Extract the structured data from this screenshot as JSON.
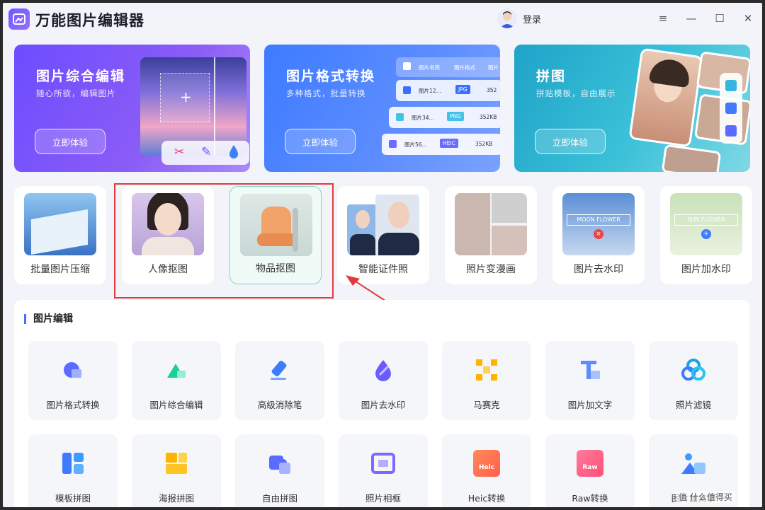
{
  "app": {
    "title": "万能图片编辑器",
    "login": "登录"
  },
  "window_controls": {
    "menu": "≡",
    "minimize": "—",
    "maximize": "☐",
    "close": "✕"
  },
  "banners": [
    {
      "title": "图片综合编辑",
      "subtitle": "随心所欲，编辑图片",
      "button": "立即体验"
    },
    {
      "title": "图片格式转换",
      "subtitle": "多种格式，批量转换",
      "button": "立即体验",
      "file_list": {
        "headers": [
          "图片名称",
          "图片格式",
          "图片"
        ],
        "rows": [
          {
            "name": "图片12...",
            "format": "JPG",
            "size": "352"
          },
          {
            "name": "图片34...",
            "format": "PNG",
            "size": "352KB"
          },
          {
            "name": "图片56...",
            "format": "HEIC",
            "size": "352KB"
          }
        ]
      }
    },
    {
      "title": "拼图",
      "subtitle": "拼贴模板，自由展示",
      "button": "立即体验"
    }
  ],
  "tools": [
    {
      "label": "批量图片压缩"
    },
    {
      "label": "人像抠图"
    },
    {
      "label": "物品抠图"
    },
    {
      "label": "智能证件照"
    },
    {
      "label": "照片变漫画"
    },
    {
      "label": "图片去水印",
      "overlay_text": "MOON FLOWER"
    },
    {
      "label": "图片加水印",
      "overlay_text": "SUN FLOWER"
    }
  ],
  "section": {
    "title": "图片编辑"
  },
  "features_row1": [
    {
      "label": "图片格式转换",
      "icon": "format-convert-icon"
    },
    {
      "label": "图片综合编辑",
      "icon": "image-edit-icon"
    },
    {
      "label": "高级消除笔",
      "icon": "eraser-pen-icon"
    },
    {
      "label": "图片去水印",
      "icon": "watermark-remove-icon"
    },
    {
      "label": "马赛克",
      "icon": "mosaic-icon"
    },
    {
      "label": "图片加文字",
      "icon": "add-text-icon"
    },
    {
      "label": "照片滤镜",
      "icon": "filter-icon"
    }
  ],
  "features_row2": [
    {
      "label": "模板拼图",
      "icon": "template-collage-icon"
    },
    {
      "label": "海报拼图",
      "icon": "poster-collage-icon"
    },
    {
      "label": "自由拼图",
      "icon": "free-collage-icon"
    },
    {
      "label": "照片相框",
      "icon": "photo-frame-icon"
    },
    {
      "label": "Heic转换",
      "icon": "heic-icon",
      "badge": "Heic"
    },
    {
      "label": "Raw转换",
      "icon": "raw-icon",
      "badge": "Raw"
    },
    {
      "label": "图片加文字",
      "icon": "image-text-icon"
    }
  ],
  "watermark": "值 什么值得买",
  "colors": {
    "accent": "#4a6cf7",
    "highlight": "#e23a3a",
    "selected_border": "#7fd6c2"
  }
}
